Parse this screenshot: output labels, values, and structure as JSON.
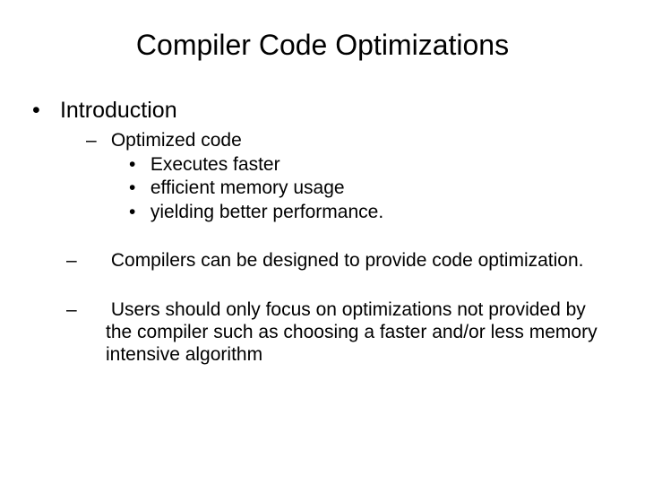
{
  "title": "Compiler Code Optimizations",
  "l1": "Introduction",
  "l2a": "Optimized code",
  "l3a": "Executes faster",
  "l3b": "efficient memory usage",
  "l3c": " yielding better performance.",
  "l2b": "Compilers can be designed to provide code optimization.",
  "l2c": "Users should only focus on optimizations not provided by the compiler such as choosing a faster and/or less memory intensive algorithm"
}
